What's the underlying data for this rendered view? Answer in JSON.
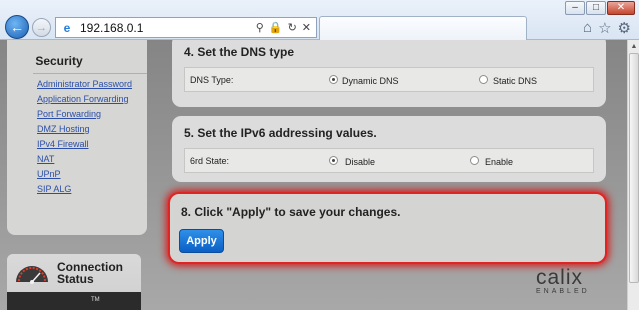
{
  "browser": {
    "url": "192.168.0.1",
    "window_controls": [
      "–",
      "□",
      "✕"
    ],
    "icons": [
      "back-icon",
      "forward-icon",
      "ie-page-icon",
      "search-dropdown-icon",
      "lock-icon",
      "refresh-icon",
      "stop-icon",
      "home-icon",
      "favorites-star-icon",
      "tools-gear-icon"
    ]
  },
  "sidebar": {
    "title": "Security",
    "items": [
      {
        "label": "Administrator Password"
      },
      {
        "label": "Application Forwarding"
      },
      {
        "label": "Port Forwarding"
      },
      {
        "label": "DMZ Hosting"
      },
      {
        "label": "IPv4 Firewall"
      },
      {
        "label": "NAT"
      },
      {
        "label": "UPnP"
      },
      {
        "label": "SIP ALG"
      }
    ],
    "connection": {
      "label": "Connection Status",
      "tm": "TM"
    }
  },
  "dns": {
    "title": "4. Set the DNS type",
    "field_label": "DNS Type:",
    "options": [
      {
        "label": "Dynamic DNS",
        "selected": true
      },
      {
        "label": "Static DNS",
        "selected": false
      }
    ]
  },
  "ipv6": {
    "title": "5. Set the IPv6 addressing values.",
    "field_label": "6rd State:",
    "options": [
      {
        "label": "Disable",
        "selected": true
      },
      {
        "label": "Enable",
        "selected": false
      }
    ]
  },
  "apply": {
    "title": "8. Click \"Apply\" to save your changes.",
    "button": "Apply",
    "highlight_color": "#e02424"
  },
  "brand": {
    "name": "calix",
    "tagline": "ENABLED"
  }
}
